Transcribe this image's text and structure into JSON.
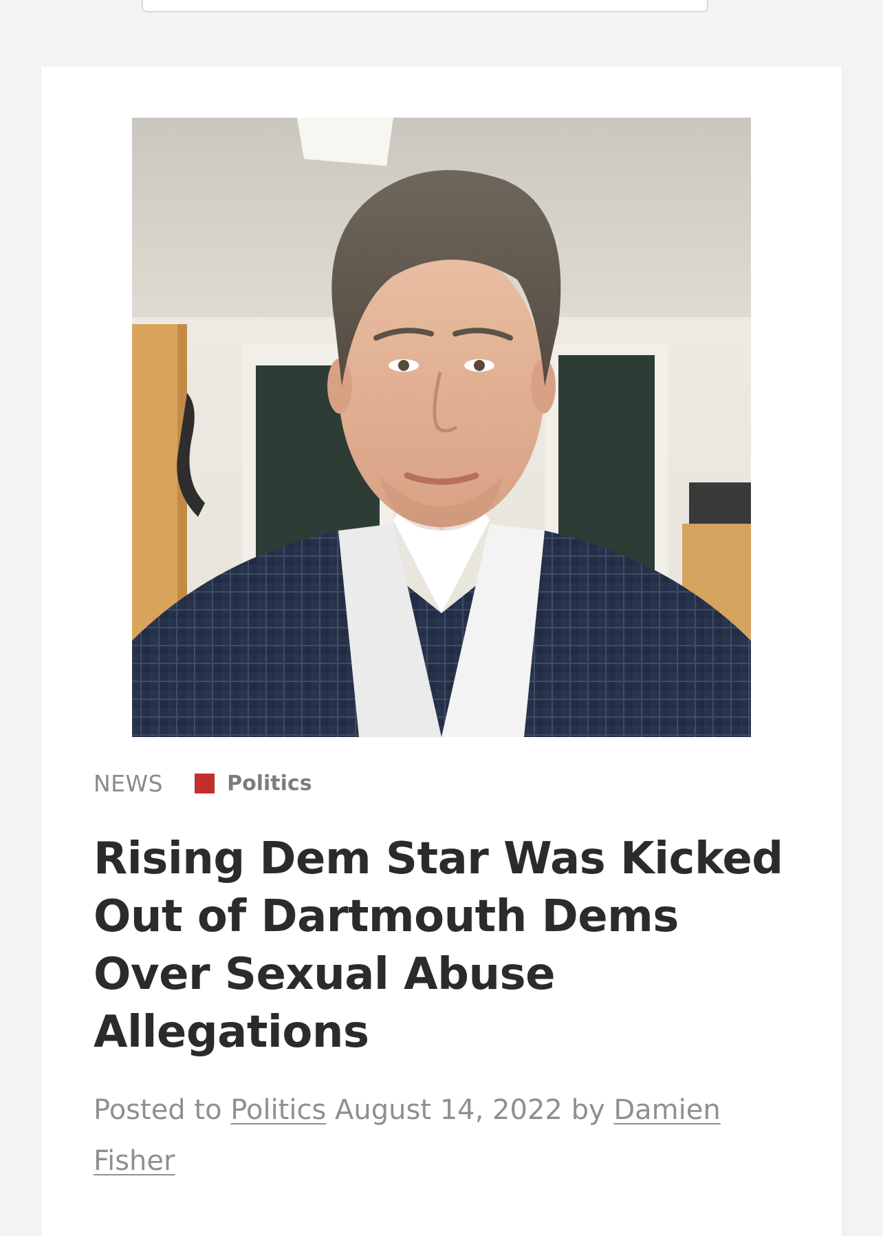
{
  "article": {
    "section": "NEWS",
    "category": {
      "label": "Politics",
      "color": "#c0302f"
    },
    "title": "Rising Dem Star Was Kicked Out of Dartmouth Dems Over Sexual Abuse Allegations",
    "byline": {
      "prefix": "Posted to",
      "category_link": "Politics",
      "date": "August 14, 2022",
      "by": "by",
      "author": "Damien Fisher"
    }
  },
  "icons": {
    "category_marker": "square-icon"
  },
  "colors": {
    "page_background": "#f3f3f3",
    "card_background": "#ffffff",
    "title_text": "#2b2b2b",
    "muted_text": "#8f8f8f"
  }
}
